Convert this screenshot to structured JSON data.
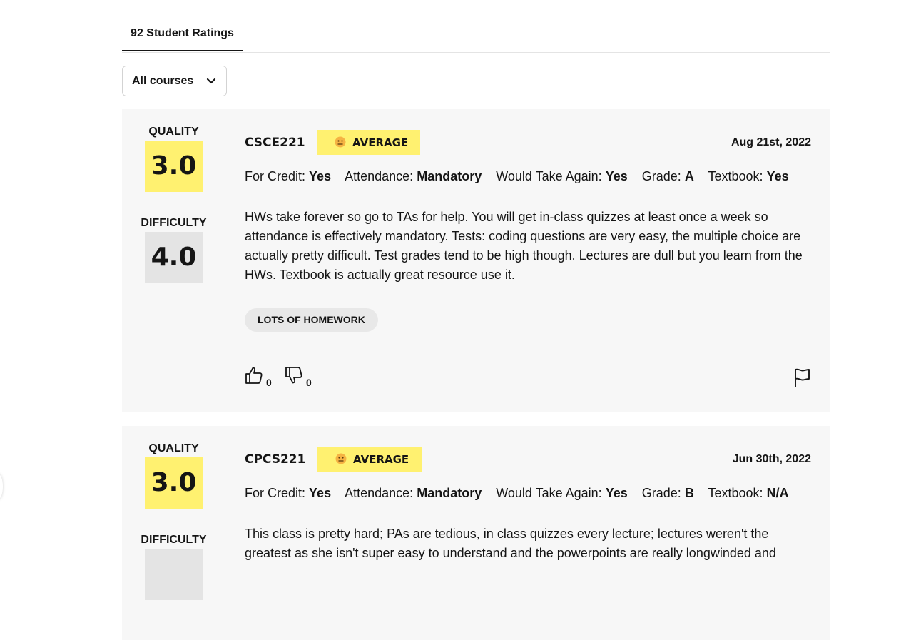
{
  "tabs": {
    "ratings_label": "92 Student Ratings"
  },
  "filter": {
    "selected": "All courses"
  },
  "labels": {
    "quality": "QUALITY",
    "difficulty": "DIFFICULTY",
    "for_credit": "For Credit:",
    "attendance": "Attendance:",
    "would_take_again": "Would Take Again:",
    "grade": "Grade:",
    "textbook": "Textbook:"
  },
  "ratings": [
    {
      "quality": "3.0",
      "difficulty": "4.0",
      "course": "CSCE221",
      "emotion": "AVERAGE",
      "date": "Aug 21st, 2022",
      "for_credit": "Yes",
      "attendance": "Mandatory",
      "would_take_again": "Yes",
      "grade": "A",
      "textbook": "Yes",
      "comment": "HWs take forever so go to TAs for help. You will get in-class quizzes at least once a week so attendance is effectively mandatory. Tests: coding questions are very easy, the multiple choice are actually pretty difficult. Test grades tend to be high though. Lectures are dull but you learn from the HWs. Textbook is actually great resource use it.",
      "tag": "LOTS OF HOMEWORK",
      "thumbs_up": "0",
      "thumbs_down": "0"
    },
    {
      "quality": "3.0",
      "course": "CPCS221",
      "emotion": "AVERAGE",
      "date": "Jun 30th, 2022",
      "for_credit": "Yes",
      "attendance": "Mandatory",
      "would_take_again": "Yes",
      "grade": "B",
      "textbook": "N/A",
      "comment": "This class is pretty hard; PAs are tedious, in class quizzes every lecture; lectures weren't the greatest as she isn't super easy to understand and the powerpoints are really longwinded and"
    }
  ],
  "icons": {
    "dropdown": "chevron-down-icon",
    "emotion": "neutral-face-icon",
    "thumbs_up": "thumbs-up-icon",
    "thumbs_down": "thumbs-down-icon",
    "report": "flag-icon"
  },
  "colors": {
    "quality_box": "#fff170",
    "difficulty_box": "#e4e4e4",
    "card_bg": "#f7f7f7",
    "tag_bg": "#e8e8e8"
  }
}
